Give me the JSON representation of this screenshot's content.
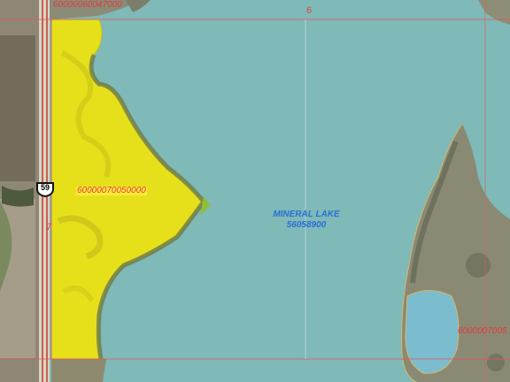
{
  "map": {
    "lake": {
      "name": "MINERAL LAKE",
      "id": "56058900",
      "water_color": "#7fb9b8"
    },
    "highway": {
      "number": "59",
      "kind": "US highway shield"
    },
    "section_number": "6",
    "parcels": {
      "top_left": "60000060047000",
      "selected": "60000070050000",
      "right_edge": "6000007005"
    },
    "section_line_label": "7",
    "colors": {
      "parcel_line": "#e05a5a",
      "selected_parcel_fill": "#e6e01a",
      "road": "#c23b2b"
    }
  }
}
